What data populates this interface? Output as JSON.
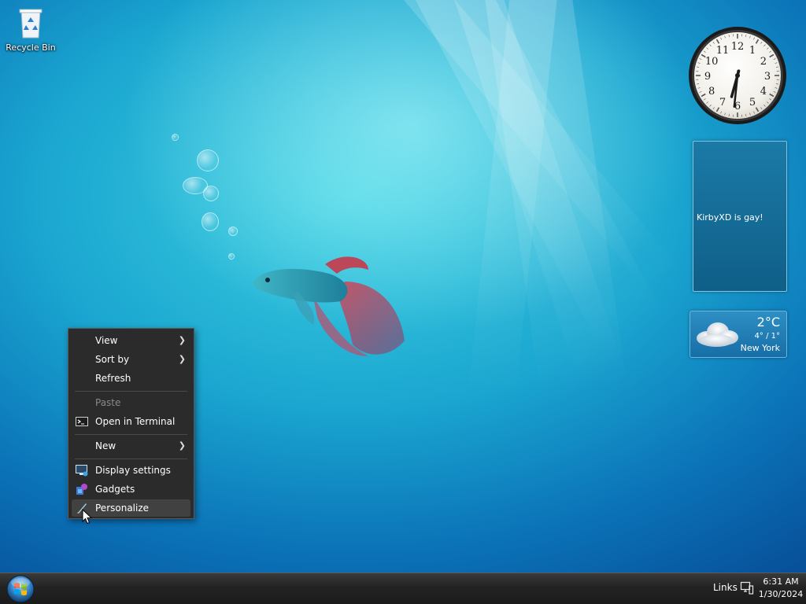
{
  "desktop": {
    "recycle_bin_label": "Recycle Bin"
  },
  "context_menu": {
    "items": [
      {
        "label": "View",
        "submenu": true,
        "enabled": true
      },
      {
        "label": "Sort by",
        "submenu": true,
        "enabled": true
      },
      {
        "label": "Refresh",
        "submenu": false,
        "enabled": true
      },
      {
        "label": "Paste",
        "submenu": false,
        "enabled": false
      },
      {
        "label": "Open in Terminal",
        "submenu": false,
        "enabled": true,
        "icon": "terminal-icon"
      },
      {
        "label": "New",
        "submenu": true,
        "enabled": true
      },
      {
        "label": "Display settings",
        "submenu": false,
        "enabled": true,
        "icon": "display-settings-icon"
      },
      {
        "label": "Gadgets",
        "submenu": false,
        "enabled": true,
        "icon": "gadgets-icon"
      },
      {
        "label": "Personalize",
        "submenu": false,
        "enabled": true,
        "icon": "personalize-icon",
        "hovered": true
      }
    ]
  },
  "gadgets": {
    "clock": {
      "numbers": [
        "12",
        "1",
        "2",
        "3",
        "4",
        "5",
        "6",
        "7",
        "8",
        "9",
        "10",
        "11"
      ],
      "time": "6:31"
    },
    "notes": {
      "text": "KirbyXD is gay!"
    },
    "weather": {
      "temperature": "2°C",
      "range": "4° / 1°",
      "city": "New York",
      "icon": "cloud-icon"
    }
  },
  "taskbar": {
    "links_label": "Links",
    "time": "6:31 AM",
    "date": "1/30/2024"
  },
  "colors": {
    "taskbar": "#232323",
    "menu_background": "#2b2b2b",
    "menu_hover": "#414141",
    "notes_background": "#1b7aa6"
  }
}
